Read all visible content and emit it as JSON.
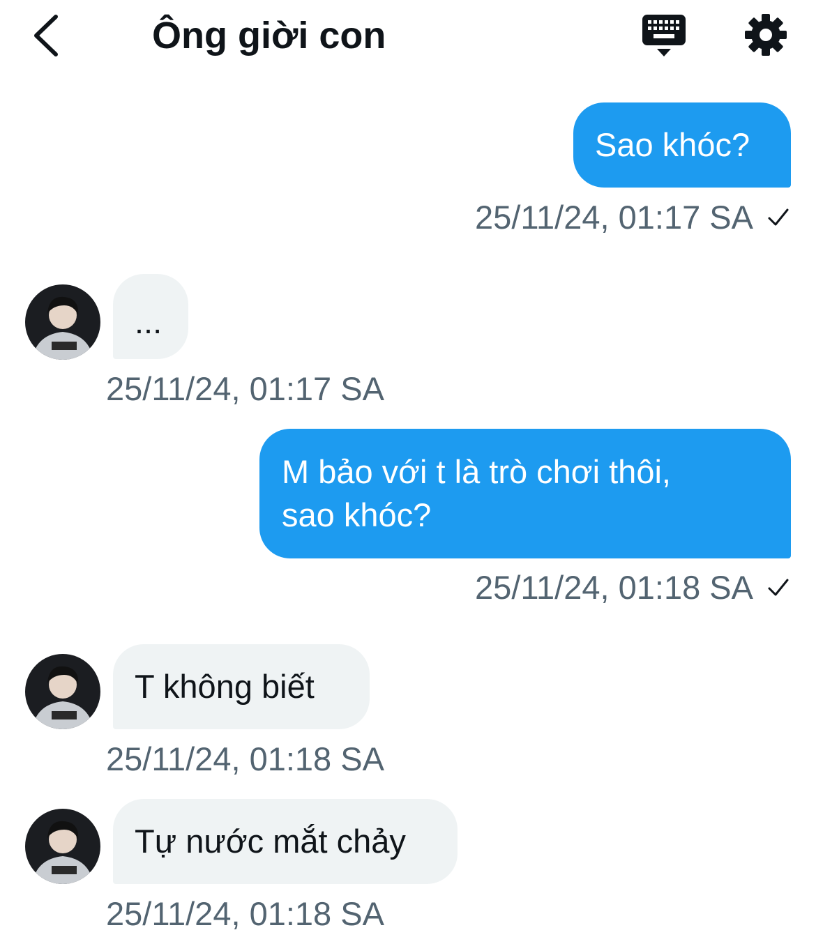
{
  "header": {
    "title": "Ông giời con",
    "back_icon": "chevron-left-icon",
    "keyboard_icon": "keyboard-icon",
    "settings_icon": "gear-icon"
  },
  "colors": {
    "outgoing_bubble": "#1d9bf0",
    "incoming_bubble": "#eff3f4",
    "timestamp": "#536471"
  },
  "messages": [
    {
      "direction": "out",
      "text": "Sao khóc?",
      "time": "25/11/24, 01:17 SA",
      "read": "✓"
    },
    {
      "direction": "in",
      "text": "...",
      "time": "25/11/24, 01:17 SA"
    },
    {
      "direction": "out",
      "line1": "M bảo với t là trò chơi thôi,",
      "line2": "sao khóc?",
      "time": "25/11/24, 01:18 SA",
      "read": "✓"
    },
    {
      "direction": "in",
      "text": "T không biết",
      "time": "25/11/24, 01:18 SA"
    },
    {
      "direction": "in",
      "text": "Tự nước mắt chảy",
      "time": "25/11/24, 01:18 SA"
    }
  ]
}
